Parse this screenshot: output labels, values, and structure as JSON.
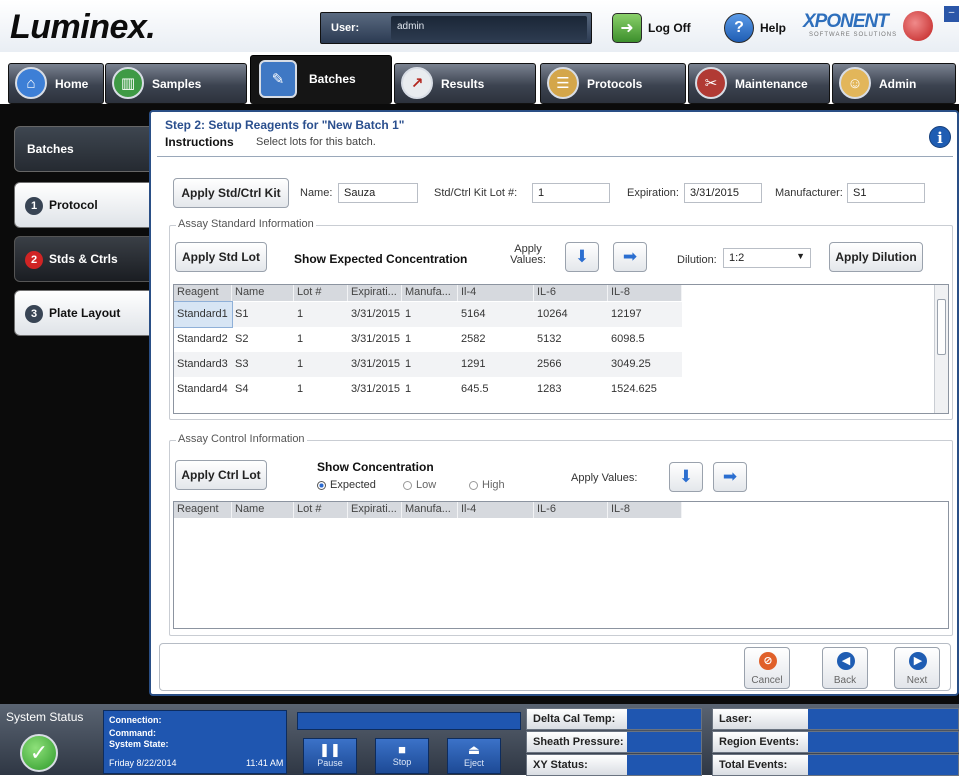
{
  "app": {
    "logo": "Luminex.",
    "user_label": "User:",
    "user_value": "admin",
    "logoff_label": "Log Off",
    "help_label": "Help",
    "brand": "XPONENT",
    "brand_sub": "SOFTWARE SOLUTIONS"
  },
  "nav": {
    "tabs": [
      {
        "label": "Home",
        "icon": "home-icon"
      },
      {
        "label": "Samples",
        "icon": "samples-icon"
      },
      {
        "label": "Batches",
        "icon": "batches-icon",
        "active": true
      },
      {
        "label": "Results",
        "icon": "results-icon"
      },
      {
        "label": "Protocols",
        "icon": "protocols-icon"
      },
      {
        "label": "Maintenance",
        "icon": "maintenance-icon"
      },
      {
        "label": "Admin",
        "icon": "admin-icon"
      }
    ]
  },
  "side": {
    "title": "Batches",
    "items": [
      {
        "num": "1",
        "label": "Protocol"
      },
      {
        "num": "2",
        "label": "Stds & Ctrls",
        "active": true
      },
      {
        "num": "3",
        "label": "Plate Layout"
      }
    ]
  },
  "step": {
    "title": "Step 2: Setup Reagents for \"New Batch 1\"",
    "instructions_label": "Instructions",
    "instructions_text": "Select lots for this batch."
  },
  "kit": {
    "apply_button": "Apply Std/Ctrl Kit",
    "name_label": "Name:",
    "name_value": "Sauza",
    "lot_label": "Std/Ctrl Kit Lot #:",
    "lot_value": "1",
    "expiration_label": "Expiration:",
    "expiration_value": "3/31/2015",
    "manufacturer_label": "Manufacturer:",
    "manufacturer_value": "S1"
  },
  "standards": {
    "section_title": "Assay Standard Information",
    "apply_lot_button": "Apply Std Lot",
    "show_expected_label": "Show Expected Concentration",
    "apply_values_label": "Apply Values:",
    "dilution_label": "Dilution:",
    "dilution_value": "1:2",
    "apply_dilution_button": "Apply Dilution",
    "columns": [
      "Reagent",
      "Name",
      "Lot #",
      "Expirati...",
      "Manufa...",
      "Il-4",
      "IL-6",
      "IL-8"
    ],
    "rows": [
      [
        "Standard1",
        "S1",
        "1",
        "3/31/2015",
        "1",
        "5164",
        "10264",
        "12197"
      ],
      [
        "Standard2",
        "S2",
        "1",
        "3/31/2015",
        "1",
        "2582",
        "5132",
        "6098.5"
      ],
      [
        "Standard3",
        "S3",
        "1",
        "3/31/2015",
        "1",
        "1291",
        "2566",
        "3049.25"
      ],
      [
        "Standard4",
        "S4",
        "1",
        "3/31/2015",
        "1",
        "645.5",
        "1283",
        "1524.625"
      ]
    ]
  },
  "controls": {
    "section_title": "Assay Control Information",
    "apply_lot_button": "Apply Ctrl Lot",
    "show_concentration_label": "Show Concentration",
    "radio_expected": "Expected",
    "radio_low": "Low",
    "radio_high": "High",
    "apply_values_label": "Apply Values:",
    "columns": [
      "Reagent",
      "Name",
      "Lot #",
      "Expirati...",
      "Manufa...",
      "Il-4",
      "IL-6",
      "IL-8"
    ]
  },
  "footer_nav": {
    "cancel": "Cancel",
    "back": "Back",
    "next": "Next"
  },
  "status": {
    "system_status": "System Status",
    "connection": "Connection:",
    "command": "Command:",
    "system_state": "System State:",
    "date": "Friday 8/22/2014",
    "time": "11:41 AM",
    "pause": "Pause",
    "stop": "Stop",
    "eject": "Eject",
    "delta_cal_temp": "Delta Cal Temp:",
    "sheath_pressure": "Sheath Pressure:",
    "xy_status": "XY Status:",
    "laser": "Laser:",
    "region_events": "Region Events:",
    "total_events": "Total Events:"
  },
  "colors": {
    "accent_blue": "#1f56b0",
    "step_title": "#2a4f8e",
    "active_step": "#d02424",
    "ok_green": "#2e9a2a"
  }
}
